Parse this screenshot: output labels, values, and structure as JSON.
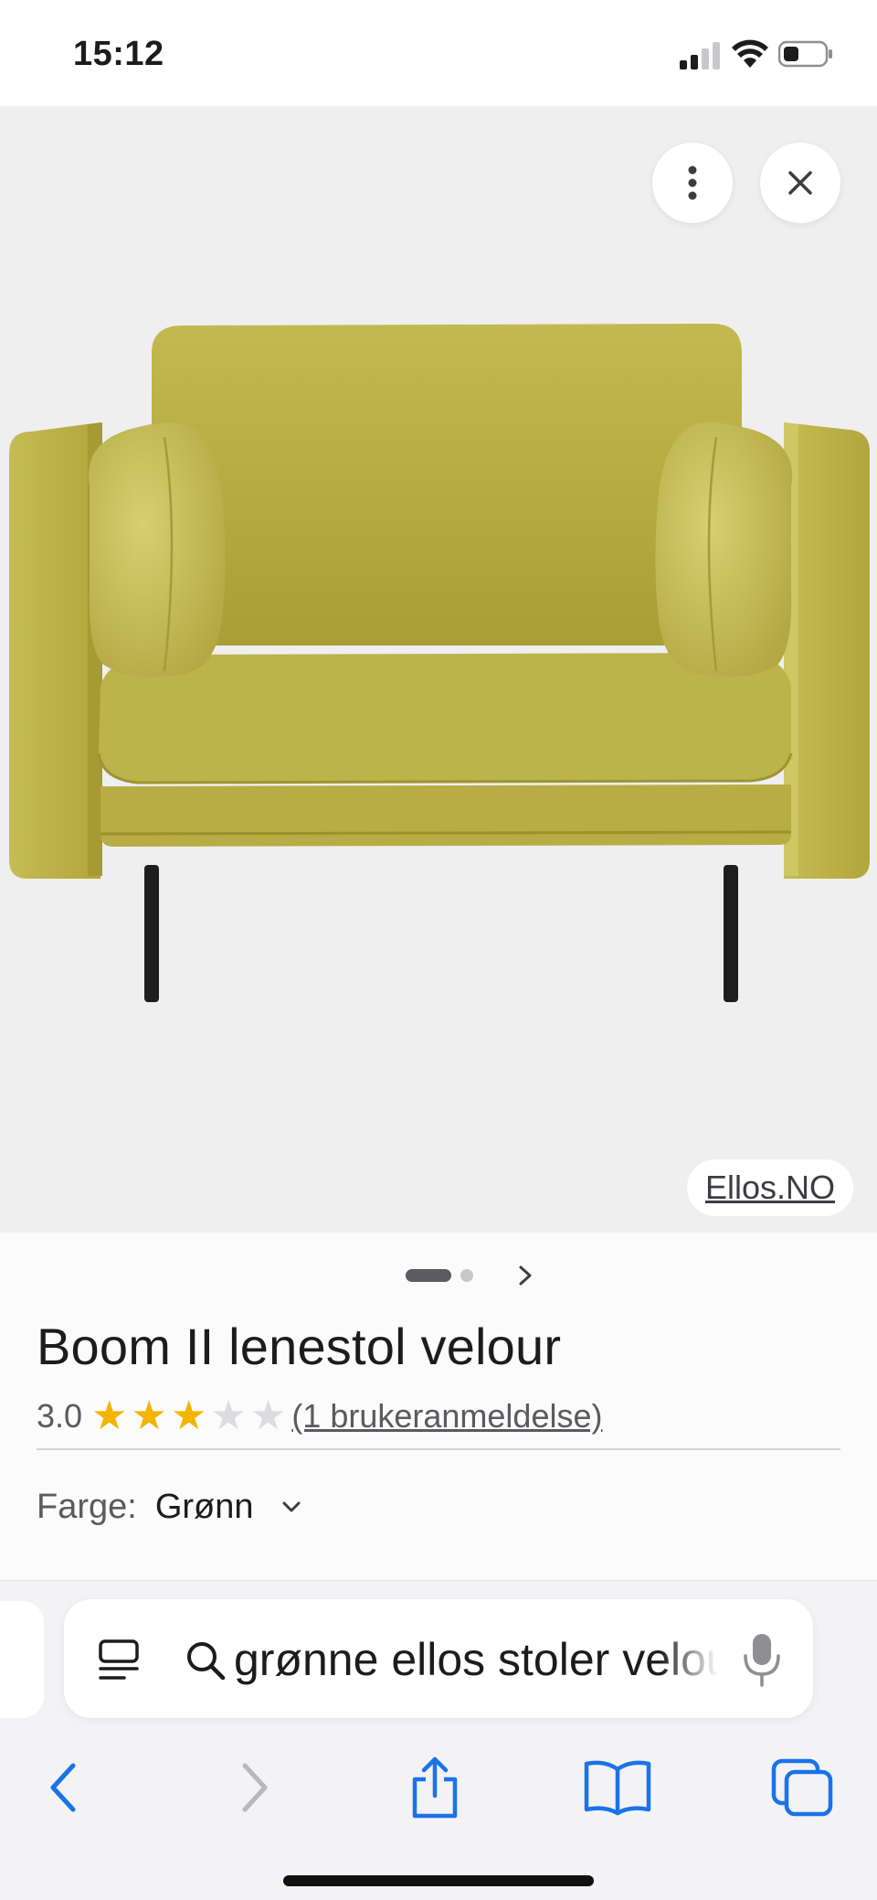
{
  "status_bar": {
    "time": "15:12"
  },
  "gallery": {
    "source_label": "Ellos.NO",
    "pages_total": 2,
    "current_page": 1,
    "product_color": "#b8ad45"
  },
  "product": {
    "title": "Boom II lenestol velour",
    "rating": {
      "value": "3.0",
      "stars_filled": 3,
      "stars_total": 5,
      "reviews_link": "(1 brukeranmeldelse)"
    },
    "color": {
      "label": "Farge:",
      "value": "Grønn"
    }
  },
  "address_bar": {
    "query": "grønne ellos stoler velour"
  },
  "toolbar": {
    "items": [
      "back-icon",
      "forward-icon",
      "share-icon",
      "bookmarks-icon",
      "tabs-icon"
    ]
  },
  "colors": {
    "accent": "#1a73e8",
    "star": "#f4b400"
  }
}
